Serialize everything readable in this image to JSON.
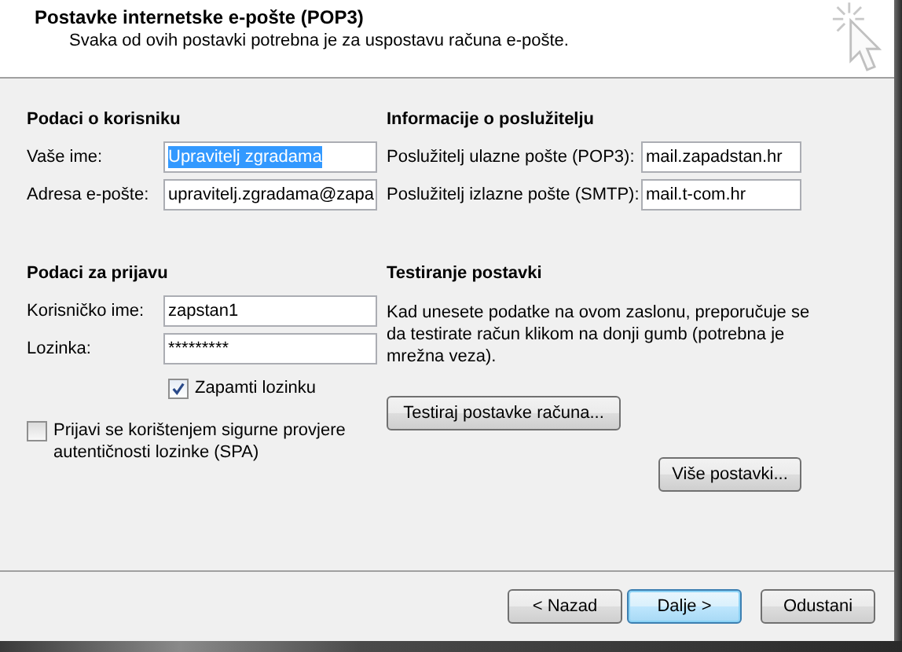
{
  "header": {
    "title": "Postavke internetske e-pošte (POP3)",
    "subtitle": "Svaka od ovih postavki potrebna je za uspostavu računa e-pošte."
  },
  "user_info": {
    "heading": "Podaci o korisniku",
    "fields": [
      {
        "label": "Vaše ime:",
        "value": "Upravitelj zgradama",
        "text_selected": true
      },
      {
        "label": "Adresa e-pošte:",
        "value": "upravitelj.zgradama@zapa",
        "text_selected": false
      }
    ]
  },
  "server_info": {
    "heading": "Informacije o poslužitelju",
    "fields": [
      {
        "label": "Poslužitelj ulazne pošte (POP3):",
        "value": "mail.zapadstan.hr",
        "text_selected": false
      },
      {
        "label": "Poslužitelj izlazne pošte (SMTP):",
        "value": "mail.t-com.hr",
        "text_selected": false
      }
    ]
  },
  "login_info": {
    "heading": "Podaci za prijavu",
    "fields": [
      {
        "label": "Korisničko ime:",
        "value": "zapstan1",
        "text_selected": false
      },
      {
        "label": "Lozinka:",
        "value": "*********",
        "text_selected": false
      }
    ],
    "remember": {
      "label": "Zapamti lozinku",
      "checked": true
    },
    "spa": {
      "label": "Prijavi se korištenjem sigurne provjere autentičnosti lozinke (SPA)",
      "checked": false
    }
  },
  "test_settings": {
    "heading": "Testiranje postavki",
    "text": "Kad unesete podatke na ovom zaslonu, preporučuje se da testirate račun klikom na donji gumb (potrebna je mrežna veza).",
    "button": "Testiraj postavke računa..."
  },
  "more_button": "Više postavki...",
  "footer_buttons": [
    {
      "label": "< Nazad",
      "default": false
    },
    {
      "label": "Dalje >",
      "default": true
    },
    {
      "label": "Odustani",
      "default": false
    }
  ]
}
